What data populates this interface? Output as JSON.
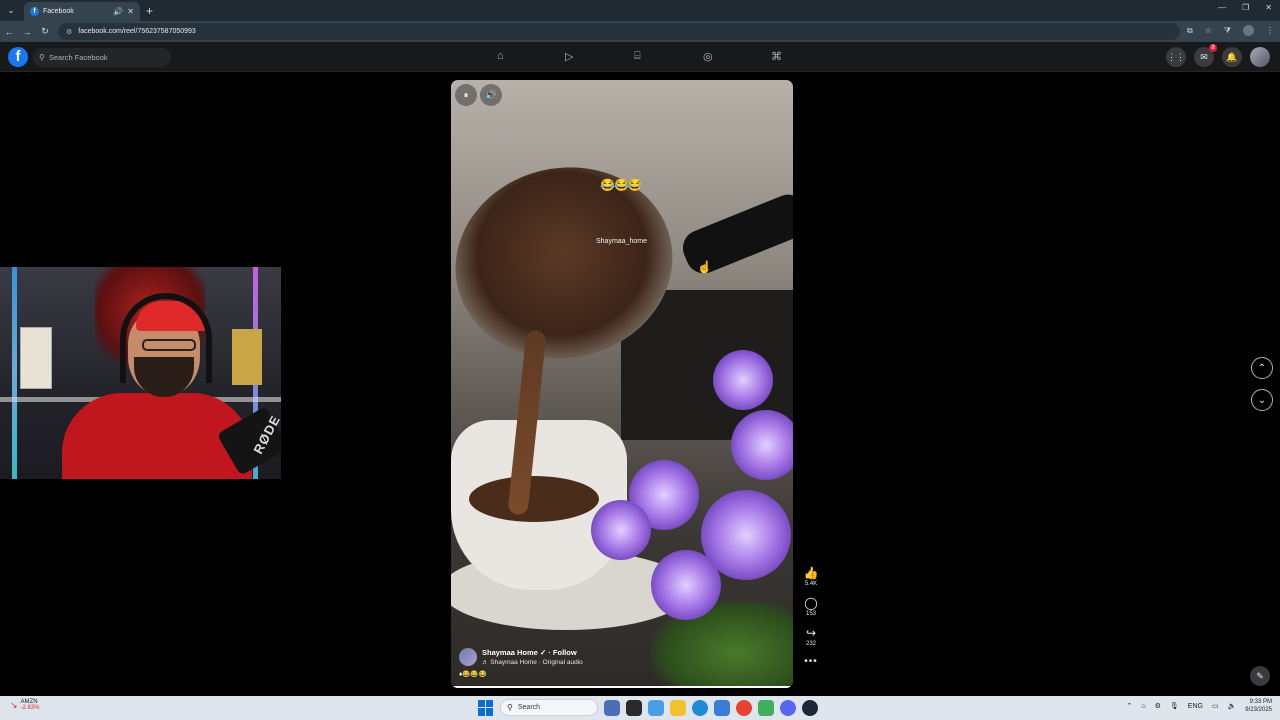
{
  "browser": {
    "tab_title": "Facebook",
    "url": "facebook.com/reel/756237587050993",
    "new_tab_symbol": "+",
    "tab_list_symbol": "⌄",
    "back": "←",
    "forward": "→",
    "reload": "↻"
  },
  "facebook": {
    "logo": "f",
    "search_placeholder": "Search Facebook",
    "nav_icons": [
      "home-icon",
      "video-icon",
      "marketplace-icon",
      "groups-icon",
      "gaming-icon"
    ],
    "notification_badge": "8"
  },
  "reel": {
    "emojis": "😂😂😂",
    "watermark": "Shaymaa_home",
    "author": "Shaymaa Home",
    "follow": "· Follow",
    "audio": "♬ Shaymaa Home · Original audio",
    "caption_emojis": "♦😂😂😂",
    "progress": 0.99,
    "likes": "5.4K",
    "comments": "153",
    "shares": "232",
    "more": "•••"
  },
  "webcam": {
    "mic_brand": "RØDE"
  },
  "taskbar": {
    "stock_name": "AMZN",
    "stock_change": "-2.83%",
    "search_label": "Search",
    "language": "ENG",
    "time": "9:33 PM",
    "date": "9/23/2025"
  },
  "colors": {
    "facebook_blue": "#1877f2",
    "page_bg": "#000000",
    "taskbar": "#dfe5ec"
  }
}
